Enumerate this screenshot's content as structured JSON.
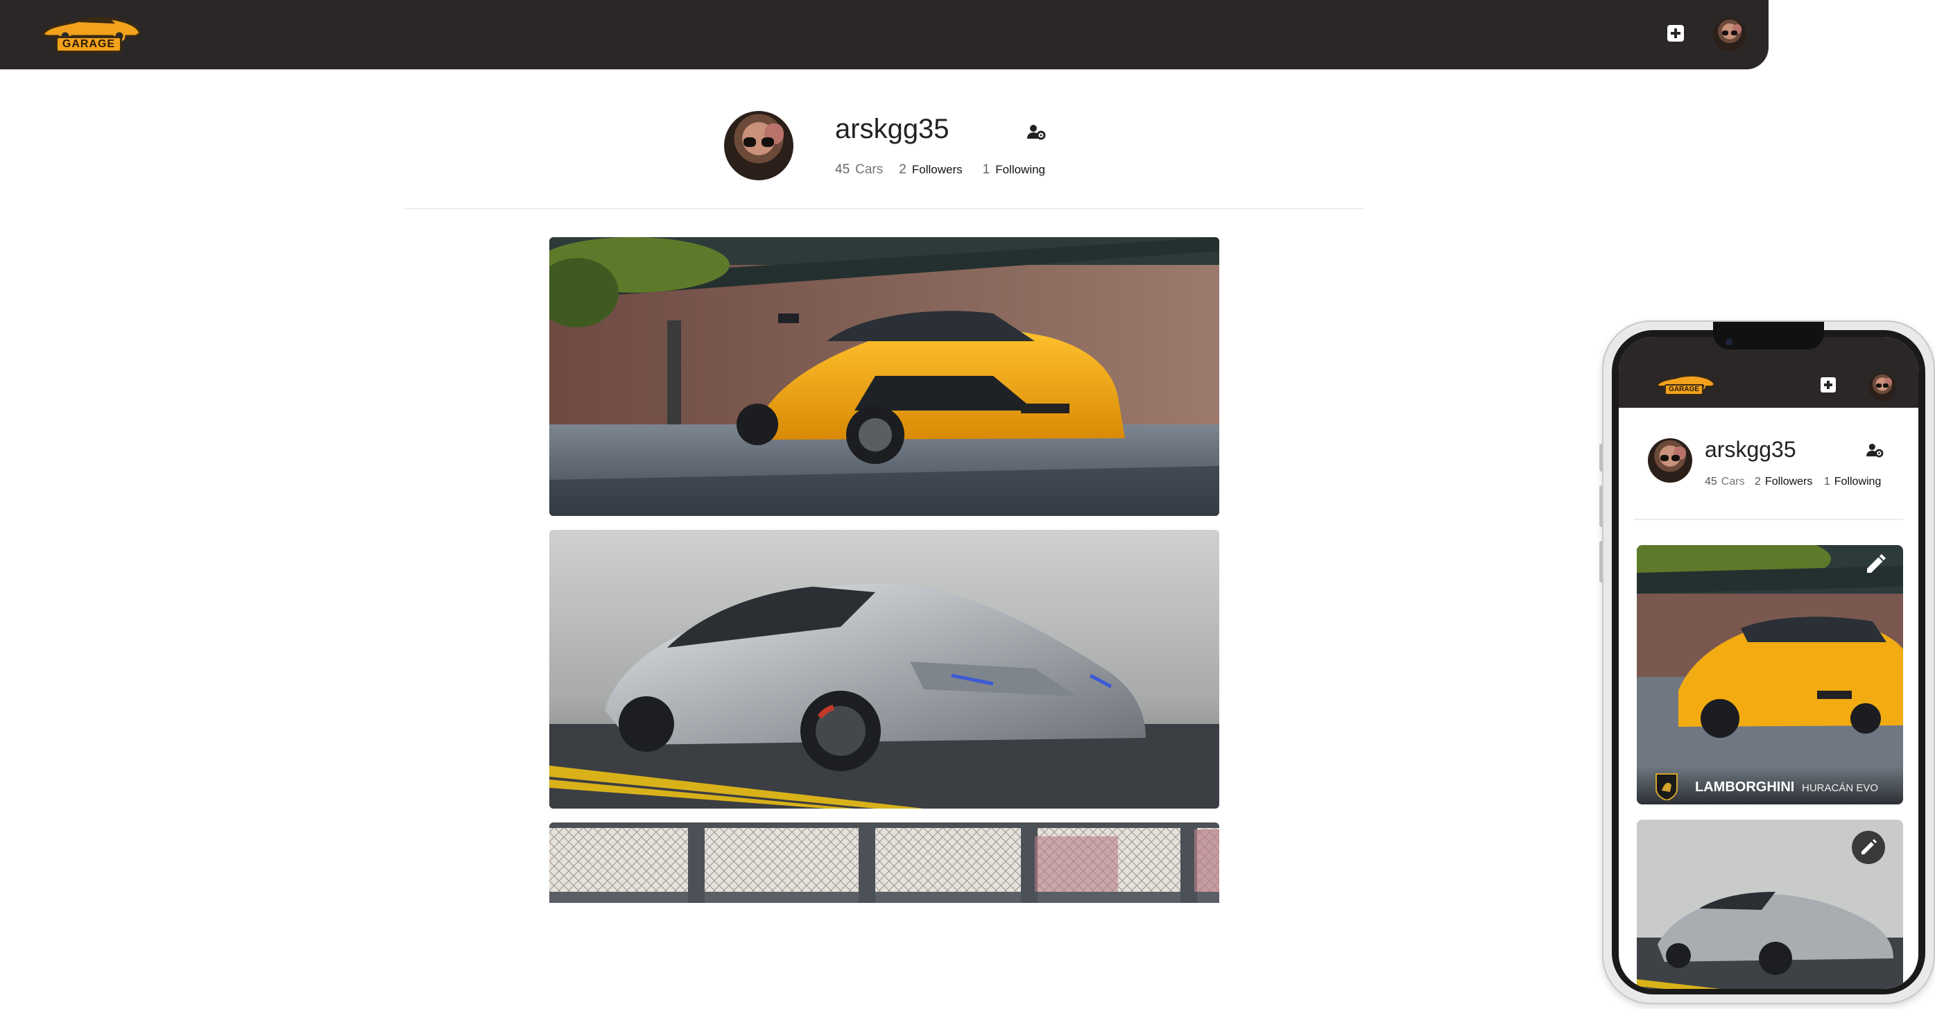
{
  "header": {
    "logo_text": "GARAGE",
    "add_icon": "plus-square-icon",
    "avatar_icon": "user-avatar"
  },
  "profile": {
    "username": "arskgg35",
    "settings_icon": "user-settings-icon",
    "cars_count": "45",
    "cars_label": "Cars",
    "followers_count": "2",
    "followers_label": "Followers",
    "following_count": "1",
    "following_label": "Following"
  },
  "cars": [
    {
      "description": "yellow widebody lamborghini huracan"
    },
    {
      "description": "silver lamborghini huracan"
    },
    {
      "description": "car photo behind fence"
    }
  ],
  "mobile": {
    "logo_text": "GARAGE",
    "username": "arskgg35",
    "cars_count": "45",
    "cars_label": "Cars",
    "followers_count": "2",
    "followers_label": "Followers",
    "following_count": "1",
    "following_label": "Following",
    "card_brand": "LAMBORGHINI",
    "card_model": "HURACÁN EVO",
    "edit_icon": "pencil-icon"
  },
  "colors": {
    "header_bg": "#2b2726",
    "logo_accent": "#f2a21c",
    "car_yellow": "#f3ab12",
    "car_silver": "#a9adb2"
  }
}
